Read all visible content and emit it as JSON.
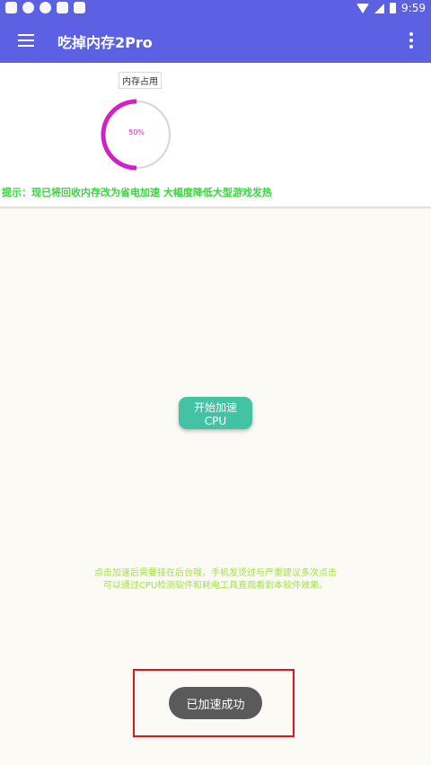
{
  "statusbar": {
    "time": "9:59",
    "icons": [
      "app-icon",
      "gamepad-icon",
      "gamepad-icon",
      "app-icon",
      "app-icon",
      "wifi-icon",
      "cell-signal-icon",
      "battery-icon"
    ]
  },
  "appbar": {
    "title": "吃掉内存2Pro",
    "menu_icon": "hamburger-menu-icon",
    "more_icon": "more-vertical-icon"
  },
  "memory_card": {
    "label": "内存占用",
    "percent_text": "50%",
    "percent_value": 0.5,
    "hint": "提示：现已将回收内存改为省电加速 大幅度降低大型游戏发热"
  },
  "actions": {
    "start_label": "开始加速CPU"
  },
  "info": {
    "line1": "点击加速后需要挂在后台哦，手机发烫过与严重建议多次点击",
    "line2": "可以通过CPU检测软件和耗电工具直观看到本软件效果。"
  },
  "toast": {
    "text": "已加速成功"
  },
  "colors": {
    "primary": "#5c60e3",
    "accent_magenta": "#d21fc6",
    "hint_green": "#39d63f",
    "button_teal": "#43c3a3",
    "info_green": "#9fe63a",
    "highlight_red": "#e0141c"
  }
}
